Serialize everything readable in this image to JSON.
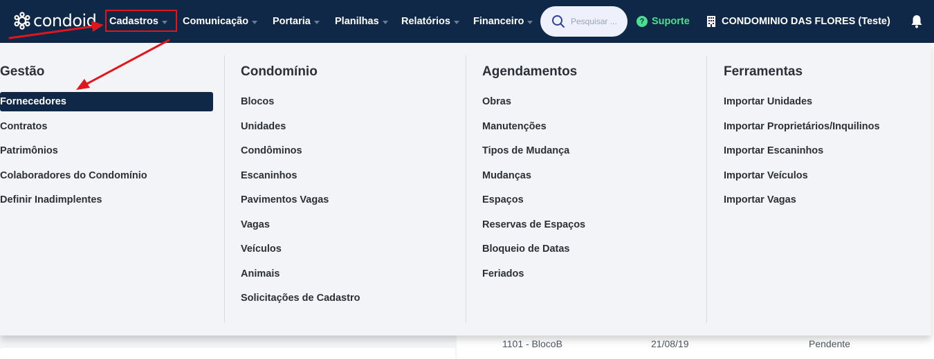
{
  "brand": {
    "name": "condoid"
  },
  "nav": {
    "items": [
      {
        "label": "Cadastros",
        "has_caret": true
      },
      {
        "label": "Comunicação",
        "has_caret": true
      },
      {
        "label": "Portaria",
        "has_caret": true
      },
      {
        "label": "Planilhas",
        "has_caret": true
      },
      {
        "label": "Relatórios",
        "has_caret": true
      },
      {
        "label": "Financeiro",
        "has_caret": true
      }
    ],
    "search_placeholder": "Pesquisar ...",
    "support_label": "Suporte",
    "condo_label": "CONDOMINIO DAS FLORES (Teste)"
  },
  "mega_menu": {
    "columns": [
      {
        "title": "Gestão",
        "items": [
          "Fornecedores",
          "Contratos",
          "Patrimônios",
          "Colaboradores do Condomínio",
          "Definir Inadimplentes"
        ],
        "active_index": 0
      },
      {
        "title": "Condomínio",
        "items": [
          "Blocos",
          "Unidades",
          "Condôminos",
          "Escaninhos",
          "Pavimentos Vagas",
          "Vagas",
          "Veículos",
          "Animais",
          "Solicitações de Cadastro"
        ]
      },
      {
        "title": "Agendamentos",
        "items": [
          "Obras",
          "Manutenções",
          "Tipos de Mudança",
          "Mudanças",
          "Espaços",
          "Reservas de Espaços",
          "Bloqueio de Datas",
          "Feriados"
        ]
      },
      {
        "title": "Ferramentas",
        "items": [
          "Importar Unidades",
          "Importar Proprietários/Inquilinos",
          "Importar Escaninhos",
          "Importar Veículos",
          "Importar Vagas"
        ]
      }
    ]
  },
  "background_table_row": {
    "unit": "1101 - BlocoB",
    "date": "21/08/19",
    "status": "Pendente"
  },
  "colors": {
    "navbar": "#0f2848",
    "menu_bg": "#f3f4f7",
    "active_item": "#0f2848",
    "support": "#4be08f",
    "annotation": "#e0161c"
  },
  "icons": [
    "condoid-logo-icon",
    "search-icon",
    "help-circle-icon",
    "building-icon",
    "bell-icon",
    "chevron-down-icon"
  ]
}
